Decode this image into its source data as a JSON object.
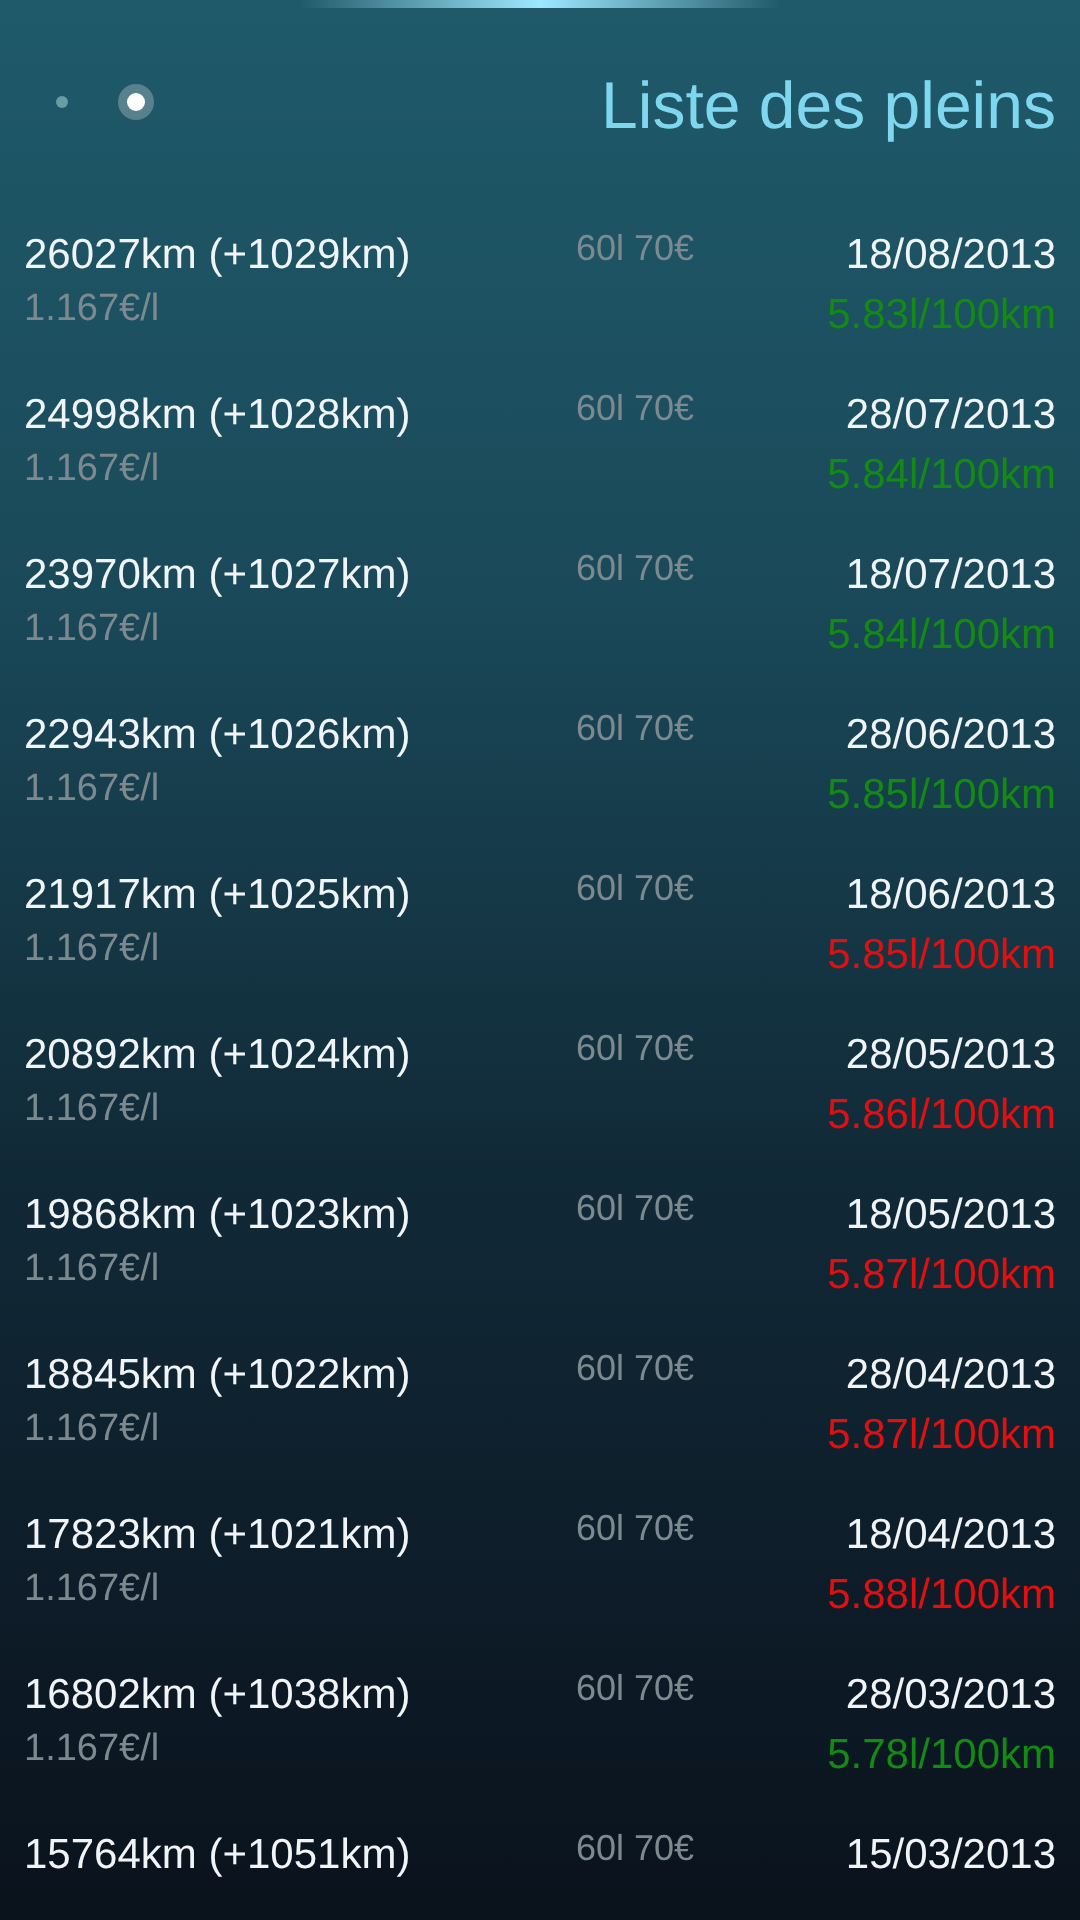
{
  "header": {
    "title": "Liste des pleins"
  },
  "entries": [
    {
      "odometer": "26027km (+1029km)",
      "fill": "60l 70€",
      "date": "18/08/2013",
      "price": "1.167€/l",
      "consumption": "5.83l/100km",
      "color": "#138a13"
    },
    {
      "odometer": "24998km (+1028km)",
      "fill": "60l 70€",
      "date": "28/07/2013",
      "price": "1.167€/l",
      "consumption": "5.84l/100km",
      "color": "#138a13"
    },
    {
      "odometer": "23970km (+1027km)",
      "fill": "60l 70€",
      "date": "18/07/2013",
      "price": "1.167€/l",
      "consumption": "5.84l/100km",
      "color": "#138a13"
    },
    {
      "odometer": "22943km (+1026km)",
      "fill": "60l 70€",
      "date": "28/06/2013",
      "price": "1.167€/l",
      "consumption": "5.85l/100km",
      "color": "#138a13"
    },
    {
      "odometer": "21917km (+1025km)",
      "fill": "60l 70€",
      "date": "18/06/2013",
      "price": "1.167€/l",
      "consumption": "5.85l/100km",
      "color": "#e01010"
    },
    {
      "odometer": "20892km (+1024km)",
      "fill": "60l 70€",
      "date": "28/05/2013",
      "price": "1.167€/l",
      "consumption": "5.86l/100km",
      "color": "#e01010"
    },
    {
      "odometer": "19868km (+1023km)",
      "fill": "60l 70€",
      "date": "18/05/2013",
      "price": "1.167€/l",
      "consumption": "5.87l/100km",
      "color": "#e01010"
    },
    {
      "odometer": "18845km (+1022km)",
      "fill": "60l 70€",
      "date": "28/04/2013",
      "price": "1.167€/l",
      "consumption": "5.87l/100km",
      "color": "#e01010"
    },
    {
      "odometer": "17823km (+1021km)",
      "fill": "60l 70€",
      "date": "18/04/2013",
      "price": "1.167€/l",
      "consumption": "5.88l/100km",
      "color": "#e01010"
    },
    {
      "odometer": "16802km (+1038km)",
      "fill": "60l 70€",
      "date": "28/03/2013",
      "price": "1.167€/l",
      "consumption": "5.78l/100km",
      "color": "#138a13"
    },
    {
      "odometer": "15764km (+1051km)",
      "fill": "60l 70€",
      "date": "15/03/2013"
    }
  ]
}
